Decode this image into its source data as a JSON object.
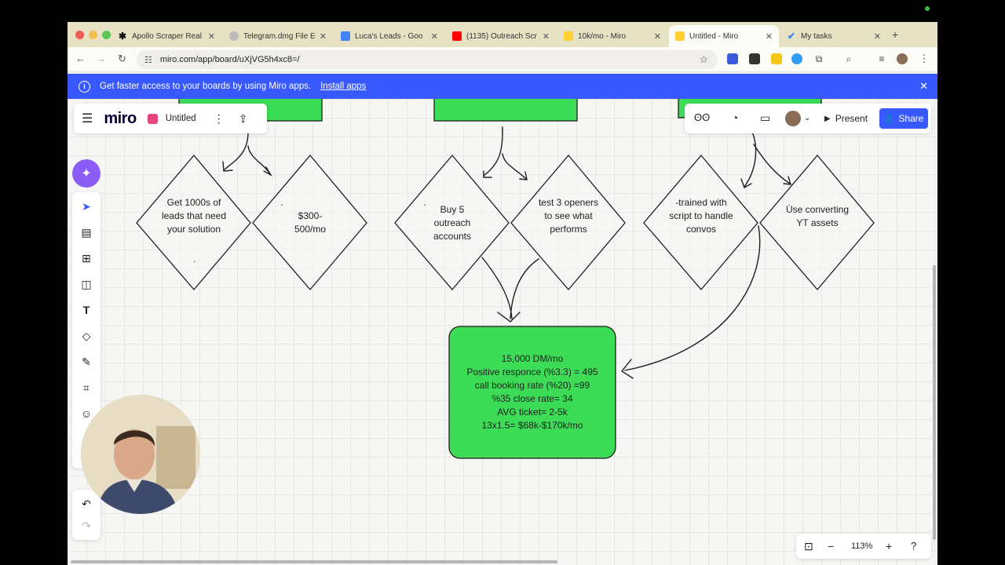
{
  "browser": {
    "tabs": [
      {
        "title": "Apollo Scraper Real",
        "active": false
      },
      {
        "title": "Telegram.dmg File E",
        "active": false
      },
      {
        "title": "Luca's Leads - Goo",
        "active": false
      },
      {
        "title": "(1135) Outreach Scr",
        "active": false
      },
      {
        "title": "10k/mo - Miro",
        "active": false
      },
      {
        "title": "Untitled - Miro",
        "active": true
      },
      {
        "title": "My tasks",
        "active": false
      }
    ],
    "url": "miro.com/app/board/uXjVG5h4xc8=/",
    "new_tab": "+",
    "close_x": "✕"
  },
  "banner": {
    "text": "Get faster access to your boards by using Miro apps.",
    "install_label": "Install apps",
    "close": "✕"
  },
  "miro": {
    "logo": "miro",
    "board_name": "Untitled",
    "present_label": "Present",
    "share_label": "Share",
    "zoom": "113%"
  },
  "board": {
    "diamonds": [
      {
        "text": "Get 1000s of leads that need your solution",
        "note": "."
      },
      {
        "text": "$300-\n500/mo",
        "note": "."
      },
      {
        "text": "Buy 5 outreach accounts",
        "note": "."
      },
      {
        "text": "test 3 openers to see what performs",
        "note": "."
      },
      {
        "text": "-trained with script to handle convos",
        "note": ""
      },
      {
        "text": "Use converting YT assets",
        "note": "."
      }
    ],
    "summary_lines": [
      "15,000 DM/mo",
      "Positive responce (%3.3) = 495",
      "call booking rate (%20) =99",
      "%35 close rate= 34",
      "AVG ticket= 2-5k",
      "13x1.5= $68k-$170k/mo"
    ]
  },
  "colors": {
    "banner": "#3859ff",
    "share": "#3859ff",
    "green_box": "#3ddc57",
    "ai_button": "#8c5cf6"
  }
}
